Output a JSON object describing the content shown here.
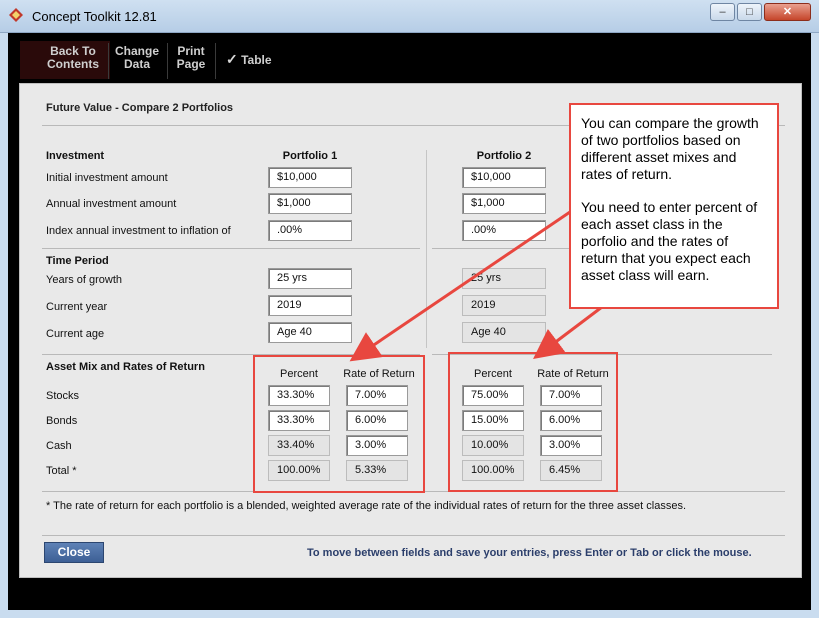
{
  "window": {
    "title": "Concept Toolkit 12.81"
  },
  "toolbar": {
    "back_line1": "Back To",
    "back_line2": "Contents",
    "change_line1": "Change",
    "change_line2": "Data",
    "print_line1": "Print",
    "print_line2": "Page",
    "table_check": "✓",
    "table_label": "Table"
  },
  "page_title": "Future Value - Compare 2 Portfolios",
  "investment": {
    "section": "Investment",
    "portfolio1_header": "Portfolio 1",
    "portfolio2_header": "Portfolio 2",
    "rows": [
      {
        "label": "Initial investment amount",
        "p1": "$10,000",
        "p2": "$10,000"
      },
      {
        "label": "Annual investment amount",
        "p1": "$1,000",
        "p2": "$1,000"
      },
      {
        "label": "Index annual investment to inflation of",
        "p1": ".00%",
        "p2": ".00%"
      }
    ]
  },
  "time_period": {
    "section": "Time Period",
    "rows": [
      {
        "label": "Years of growth",
        "p1": "25 yrs",
        "p2": "25 yrs"
      },
      {
        "label": "Current year",
        "p1": "2019",
        "p2": "2019"
      },
      {
        "label": "Current age",
        "p1": "Age 40",
        "p2": "Age 40"
      }
    ]
  },
  "asset_mix": {
    "section": "Asset Mix and Rates of Return",
    "percent_header": "Percent",
    "rate_header": "Rate of Return",
    "rows": [
      {
        "label": "Stocks",
        "p1_pct": "33.30%",
        "p1_rate": "7.00%",
        "p2_pct": "75.00%",
        "p2_rate": "7.00%"
      },
      {
        "label": "Bonds",
        "p1_pct": "33.30%",
        "p1_rate": "6.00%",
        "p2_pct": "15.00%",
        "p2_rate": "6.00%"
      },
      {
        "label": "Cash",
        "p1_pct": "33.40%",
        "p1_rate": "3.00%",
        "p2_pct": "10.00%",
        "p2_rate": "3.00%"
      },
      {
        "label": "Total *",
        "p1_pct": "100.00%",
        "p1_rate": "5.33%",
        "p2_pct": "100.00%",
        "p2_rate": "6.45%"
      }
    ]
  },
  "footnote": "* The rate of return for each portfolio is a blended, weighted average rate of the individual rates of return for the three asset classes.",
  "close_label": "Close",
  "hint": "To move between fields and save your entries, press Enter or Tab or click the mouse.",
  "callout": {
    "para1": "You can compare the growth of two portfolios based on different asset mixes and rates of return.",
    "para2": "You need to enter percent of each asset class in the porfolio and the rates of return that you expect each asset class will earn."
  },
  "colors": {
    "annotation_red": "#e8473f",
    "button_blue": "#4a6da4"
  }
}
